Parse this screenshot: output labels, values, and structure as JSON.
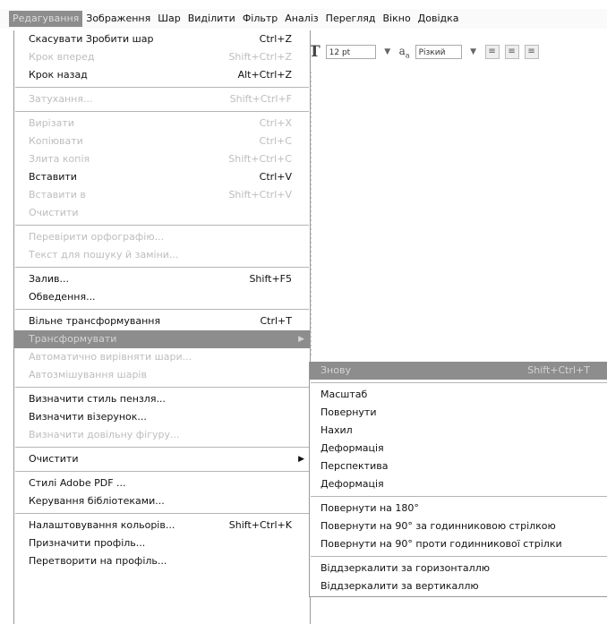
{
  "menubar": {
    "items": [
      {
        "label": "Редагування",
        "active": true
      },
      {
        "label": "Зображення"
      },
      {
        "label": "Шар"
      },
      {
        "label": "Виділити"
      },
      {
        "label": "Фільтр"
      },
      {
        "label": "Аналіз"
      },
      {
        "label": "Перегляд"
      },
      {
        "label": "Вікно"
      },
      {
        "label": "Довідка"
      }
    ]
  },
  "options_bar": {
    "font_size": "12 pt",
    "antialias": "Різкий"
  },
  "edit_menu": {
    "groups": [
      [
        {
          "label": "Скасувати Зробити шар",
          "shortcut": "Ctrl+Z",
          "enabled": true
        },
        {
          "label": "Крок вперед",
          "shortcut": "Shift+Ctrl+Z",
          "enabled": false
        },
        {
          "label": "Крок назад",
          "shortcut": "Alt+Ctrl+Z",
          "enabled": true
        }
      ],
      [
        {
          "label": "Затухання...",
          "shortcut": "Shift+Ctrl+F",
          "enabled": false
        }
      ],
      [
        {
          "label": "Вирізати",
          "shortcut": "Ctrl+X",
          "enabled": false
        },
        {
          "label": "Копіювати",
          "shortcut": "Ctrl+C",
          "enabled": false
        },
        {
          "label": "Злита копія",
          "shortcut": "Shift+Ctrl+C",
          "enabled": false
        },
        {
          "label": "Вставити",
          "shortcut": "Ctrl+V",
          "enabled": true
        },
        {
          "label": "Вставити в",
          "shortcut": "Shift+Ctrl+V",
          "enabled": false
        },
        {
          "label": "Очистити",
          "shortcut": "",
          "enabled": false
        }
      ],
      [
        {
          "label": "Перевірити орфографію...",
          "shortcut": "",
          "enabled": false
        },
        {
          "label": "Текст для пошуку й заміни...",
          "shortcut": "",
          "enabled": false
        }
      ],
      [
        {
          "label": "Залив...",
          "shortcut": "Shift+F5",
          "enabled": true
        },
        {
          "label": "Обведення...",
          "shortcut": "",
          "enabled": true
        }
      ],
      [
        {
          "label": "Вільне трансформування",
          "shortcut": "Ctrl+T",
          "enabled": true
        },
        {
          "label": "Трансформувати",
          "shortcut": "",
          "enabled": true,
          "submenu": true,
          "highlight": true
        },
        {
          "label": "Автоматично вирівняти шари...",
          "shortcut": "",
          "enabled": false
        },
        {
          "label": "Автозмішування шарів",
          "shortcut": "",
          "enabled": false
        }
      ],
      [
        {
          "label": "Визначити стиль пензля...",
          "shortcut": "",
          "enabled": true
        },
        {
          "label": "Визначити візерунок...",
          "shortcut": "",
          "enabled": true
        },
        {
          "label": "Визначити довільну фігуру...",
          "shortcut": "",
          "enabled": false
        }
      ],
      [
        {
          "label": "Очистити",
          "shortcut": "",
          "enabled": true,
          "submenu": true
        }
      ],
      [
        {
          "label": "Стилі Adobe PDF ...",
          "shortcut": "",
          "enabled": true
        },
        {
          "label": "Керування бібліотеками...",
          "shortcut": "",
          "enabled": true
        }
      ],
      [
        {
          "label": "Налаштовування кольорів...",
          "shortcut": "Shift+Ctrl+K",
          "enabled": true
        },
        {
          "label": "Призначити профіль...",
          "shortcut": "",
          "enabled": true
        },
        {
          "label": "Перетворити на профіль...",
          "shortcut": "",
          "enabled": true
        }
      ]
    ]
  },
  "transform_submenu": {
    "groups": [
      [
        {
          "label": "Знову",
          "shortcut": "Shift+Ctrl+T",
          "enabled": false,
          "highlight": true
        }
      ],
      [
        {
          "label": "Масштаб",
          "shortcut": "",
          "enabled": true
        },
        {
          "label": "Повернути",
          "shortcut": "",
          "enabled": true
        },
        {
          "label": "Нахил",
          "shortcut": "",
          "enabled": true
        },
        {
          "label": "Деформація",
          "shortcut": "",
          "enabled": true
        },
        {
          "label": "Перспектива",
          "shortcut": "",
          "enabled": true
        },
        {
          "label": "Деформація",
          "shortcut": "",
          "enabled": true
        }
      ],
      [
        {
          "label": "Повернути на 180°",
          "shortcut": "",
          "enabled": true
        },
        {
          "label": "Повернути на 90° за годинниковою стрілкою",
          "shortcut": "",
          "enabled": true
        },
        {
          "label": "Повернути на 90° проти годинникової стрілки",
          "shortcut": "",
          "enabled": true
        }
      ],
      [
        {
          "label": "Віддзеркалити за горизонталлю",
          "shortcut": "",
          "enabled": true
        },
        {
          "label": "Віддзеркалити за вертикаллю",
          "shortcut": "",
          "enabled": true
        }
      ]
    ]
  }
}
